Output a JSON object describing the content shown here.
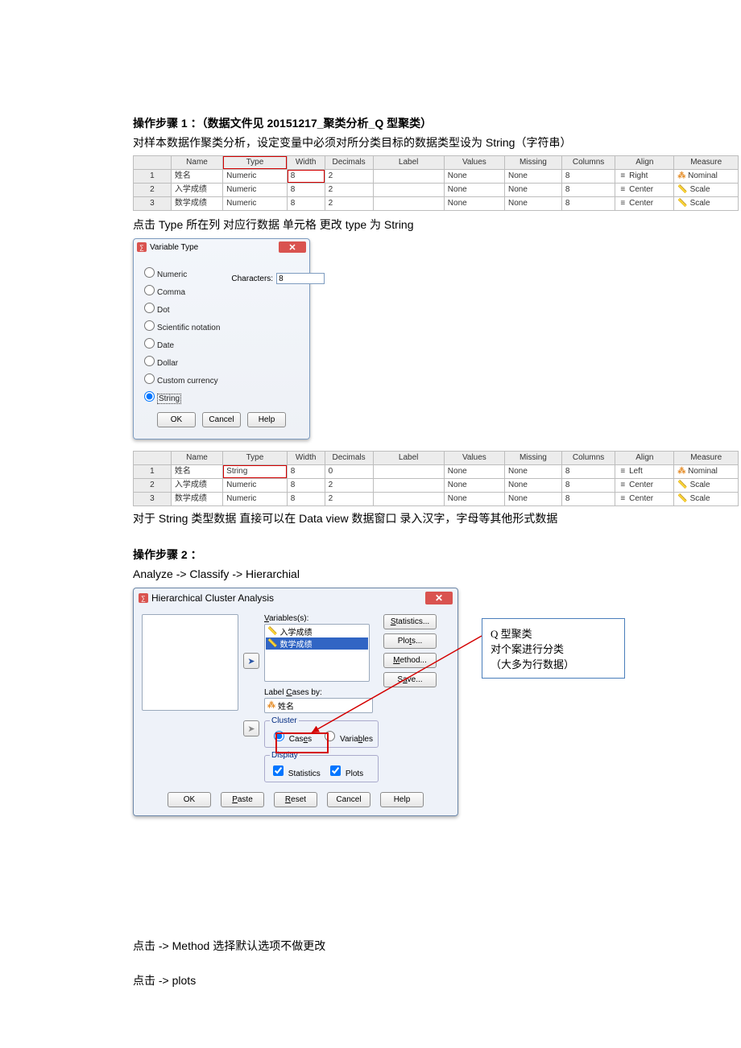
{
  "step1": {
    "title": "操作步骤 1 ：（数据文件见  20151217_聚类分析_Q 型聚类）",
    "desc": "对样本数据作聚类分析，设定变量中必须对所分类目标的数据类型设为  String（字符串）",
    "note2": "点击 Type 所在列  对应行数据  单元格    更改 type  为  String",
    "note3": "对于 String  类型数据  直接可以在 Data view 数据窗口  录入汉字，字母等其他形式数据"
  },
  "headers": {
    "row": "",
    "name": "Name",
    "type": "Type",
    "width": "Width",
    "dec": "Decimals",
    "label": "Label",
    "values": "Values",
    "missing": "Missing",
    "columns": "Columns",
    "align": "Align",
    "measure": "Measure"
  },
  "tableA": [
    {
      "n": "1",
      "name": "姓名",
      "type": "Numeric",
      "w": "8",
      "d": "2",
      "label": "",
      "vals": "None",
      "miss": "None",
      "cols": "8",
      "align": "Right",
      "meas": "Nominal"
    },
    {
      "n": "2",
      "name": "入学成绩",
      "type": "Numeric",
      "w": "8",
      "d": "2",
      "label": "",
      "vals": "None",
      "miss": "None",
      "cols": "8",
      "align": "Center",
      "meas": "Scale"
    },
    {
      "n": "3",
      "name": "数学成绩",
      "type": "Numeric",
      "w": "8",
      "d": "2",
      "label": "",
      "vals": "None",
      "miss": "None",
      "cols": "8",
      "align": "Center",
      "meas": "Scale"
    }
  ],
  "tableB": [
    {
      "n": "1",
      "name": "姓名",
      "type": "String",
      "w": "8",
      "d": "0",
      "label": "",
      "vals": "None",
      "miss": "None",
      "cols": "8",
      "align": "Left",
      "meas": "Nominal"
    },
    {
      "n": "2",
      "name": "入学成绩",
      "type": "Numeric",
      "w": "8",
      "d": "2",
      "label": "",
      "vals": "None",
      "miss": "None",
      "cols": "8",
      "align": "Center",
      "meas": "Scale"
    },
    {
      "n": "3",
      "name": "数学成绩",
      "type": "Numeric",
      "w": "8",
      "d": "2",
      "label": "",
      "vals": "None",
      "miss": "None",
      "cols": "8",
      "align": "Center",
      "meas": "Scale"
    }
  ],
  "vtDialog": {
    "title": "Variable Type",
    "opts": {
      "numeric": "Numeric",
      "comma": "Comma",
      "dot": "Dot",
      "sci": "Scientific notation",
      "date": "Date",
      "dollar": "Dollar",
      "custom": "Custom currency",
      "string": "String"
    },
    "charsLabel": "Characters:",
    "charsValue": "8",
    "ok": "OK",
    "cancel": "Cancel",
    "help": "Help"
  },
  "step2": {
    "title": "操作步骤 2 ：",
    "path": "Analyze -> Classify -> Hierarchial"
  },
  "hca": {
    "title": "Hierarchical Cluster Analysis",
    "varsLabel": "Variables(s):",
    "vars": [
      "入学成绩",
      "数学成绩"
    ],
    "labelCases": "Label Cases by:",
    "labelVar": "姓名",
    "cluster": {
      "legend": "Cluster",
      "cases": "Cases",
      "variables": "Variables"
    },
    "display": {
      "legend": "Display",
      "stats": "Statistics",
      "plots": "Plots"
    },
    "right": {
      "statistics": "Statistics...",
      "plots": "Plots...",
      "method": "Method...",
      "save": "Save..."
    },
    "bottom": {
      "ok": "OK",
      "paste": "Paste",
      "reset": "Reset",
      "cancel": "Cancel",
      "help": "Help"
    }
  },
  "anno": {
    "l1": "Q 型聚类",
    "l2": "对个案进行分类",
    "l3": "（大多为行数据）"
  },
  "trailing": {
    "method": "点击  -> Method  选择默认选项不做更改",
    "plots": "点击  -> plots"
  }
}
